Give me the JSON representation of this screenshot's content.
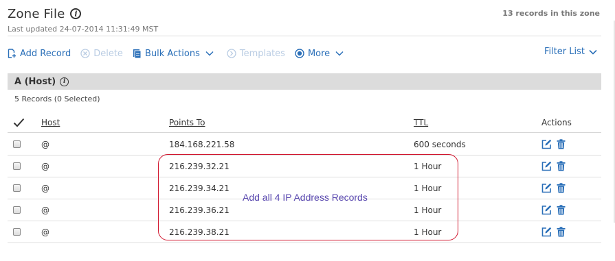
{
  "header": {
    "title": "Zone File",
    "last_updated": "Last updated 24-07-2014 11:31:49 MST",
    "record_count": "13 records in this zone"
  },
  "toolbar": {
    "add_record": "Add Record",
    "delete": "Delete",
    "bulk_actions": "Bulk Actions",
    "templates": "Templates",
    "more": "More",
    "filter_list": "Filter List"
  },
  "section": {
    "title": "A (Host)",
    "selection": "5 Records (0 Selected)"
  },
  "columns": {
    "host": "Host",
    "points_to": "Points To",
    "ttl": "TTL",
    "actions": "Actions"
  },
  "records": [
    {
      "host": "@",
      "points_to": "184.168.221.58",
      "ttl": "600 seconds"
    },
    {
      "host": "@",
      "points_to": "216.239.32.21",
      "ttl": "1 Hour"
    },
    {
      "host": "@",
      "points_to": "216.239.34.21",
      "ttl": "1 Hour"
    },
    {
      "host": "@",
      "points_to": "216.239.36.21",
      "ttl": "1 Hour"
    },
    {
      "host": "@",
      "points_to": "216.239.38.21",
      "ttl": "1 Hour"
    }
  ],
  "annotation": {
    "text": "Add all 4 IP Address Records"
  },
  "colors": {
    "accent": "#2a6fb8",
    "disabled": "#b9cce3",
    "section_bg": "#dcdcdc",
    "annotation_border": "#d1162e",
    "annotation_text": "#5a49b0"
  }
}
